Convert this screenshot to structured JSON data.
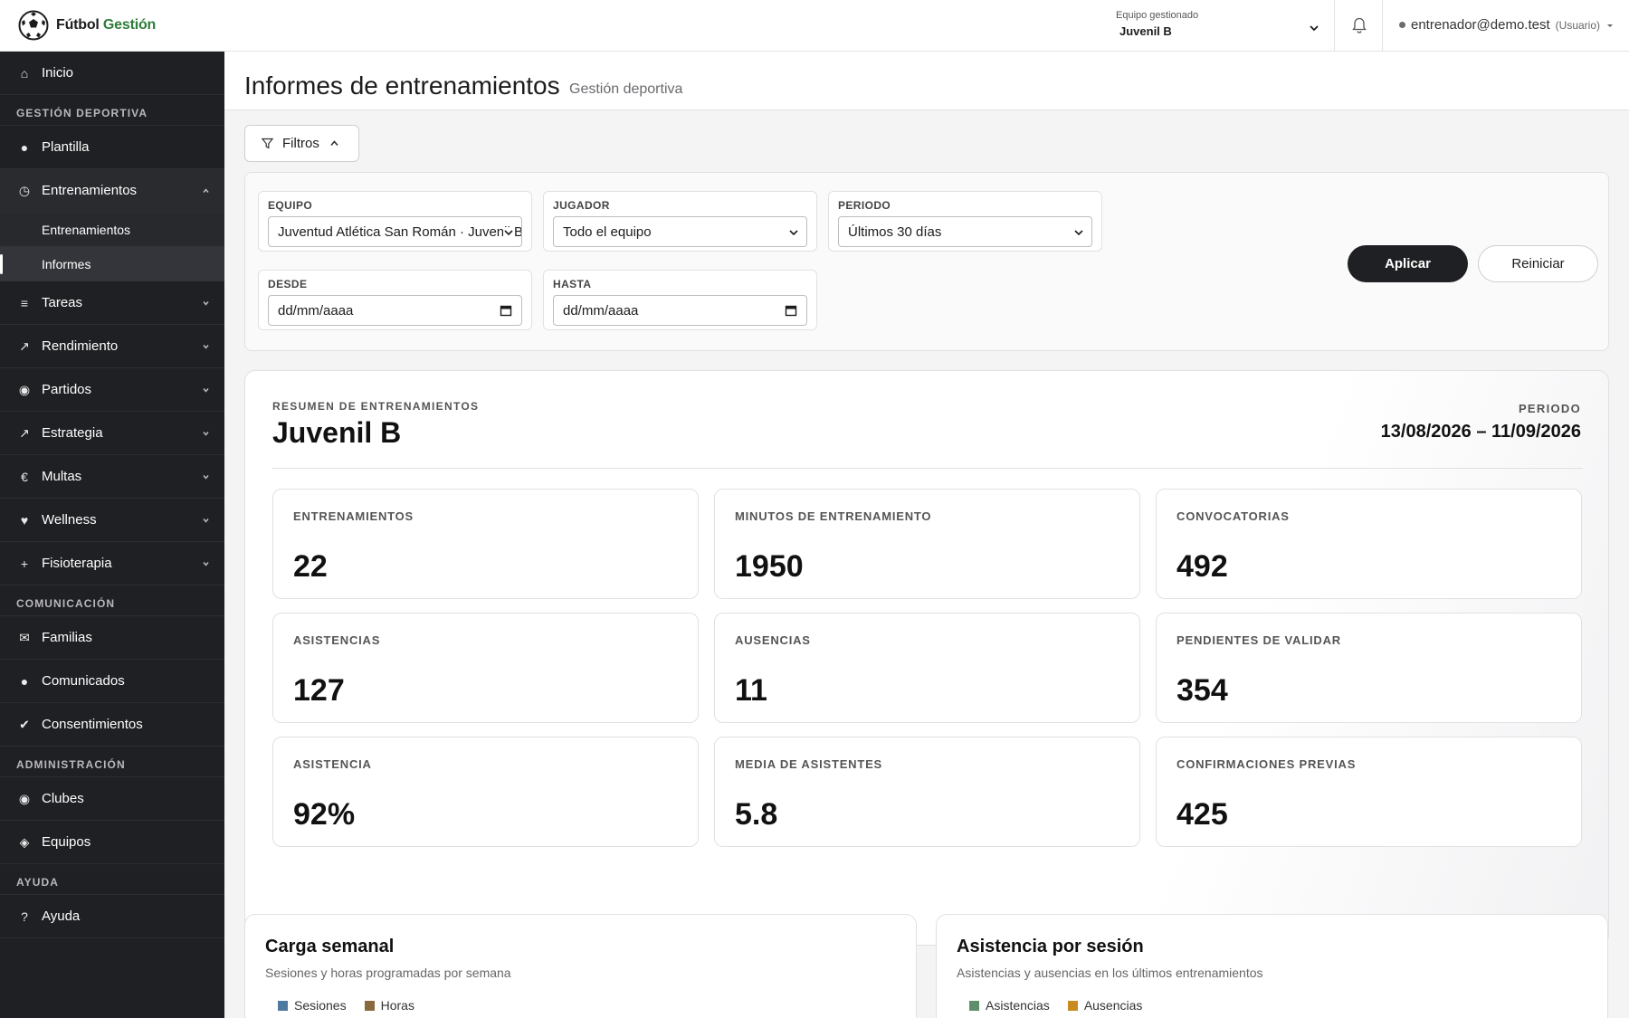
{
  "app": {
    "brand_main": "Fútbol",
    "brand_accent": "Gestión"
  },
  "header": {
    "team_label": "Equipo gestionado",
    "team_value": "Juvenil B",
    "user_email": "entrenador@demo.test",
    "user_role": "(Usuario)"
  },
  "sidebar": {
    "home": "Inicio",
    "sec_deportiva": "GESTIÓN DEPORTIVA",
    "plantilla": "Plantilla",
    "entrenamientos": "Entrenamientos",
    "sub_entrenamientos": "Entrenamientos",
    "sub_informes": "Informes",
    "tareas": "Tareas",
    "rendimiento": "Rendimiento",
    "partidos": "Partidos",
    "estrategia": "Estrategia",
    "multas": "Multas",
    "wellness": "Wellness",
    "fisioterapia": "Fisioterapia",
    "sec_comunicacion": "COMUNICACIÓN",
    "familias": "Familias",
    "comunicados": "Comunicados",
    "consentimientos": "Consentimientos",
    "sec_admin": "ADMINISTRACIÓN",
    "clubes": "Clubes",
    "equipos": "Equipos",
    "sec_ayuda": "AYUDA",
    "ayuda": "Ayuda"
  },
  "page": {
    "title": "Informes de entrenamientos",
    "subtitle": "Gestión deportiva"
  },
  "filters": {
    "toggle_label": "Filtros",
    "equipo_label": "EQUIPO",
    "equipo_value": "Juventud Atlética San Román · Juvenil B",
    "jugador_label": "JUGADOR",
    "jugador_value": "Todo el equipo",
    "periodo_label": "PERIODO",
    "periodo_value": "Últimos 30 días",
    "desde_label": "DESDE",
    "desde_value": "dd/mm/aaaa",
    "hasta_label": "HASTA",
    "hasta_value": "dd/mm/aaaa",
    "apply": "Aplicar",
    "reset": "Reiniciar"
  },
  "summary": {
    "kicker": "RESUMEN DE ENTRENAMIENTOS",
    "team": "Juvenil B",
    "period_label": "PERIODO",
    "period_value": "13/08/2026 – 11/09/2026",
    "stats": [
      {
        "label": "ENTRENAMIENTOS",
        "value": "22"
      },
      {
        "label": "MINUTOS DE ENTRENAMIENTO",
        "value": "1950"
      },
      {
        "label": "CONVOCATORIAS",
        "value": "492"
      },
      {
        "label": "ASISTENCIAS",
        "value": "127"
      },
      {
        "label": "AUSENCIAS",
        "value": "11"
      },
      {
        "label": "PENDIENTES DE VALIDAR",
        "value": "354"
      },
      {
        "label": "ASISTENCIA",
        "value": "92%"
      },
      {
        "label": "MEDIA DE ASISTENTES",
        "value": "5.8"
      },
      {
        "label": "CONFIRMACIONES PREVIAS",
        "value": "425"
      }
    ]
  },
  "cards": {
    "carga": {
      "title": "Carga semanal",
      "subtitle": "Sesiones y horas programadas por semana",
      "legend_1": "Sesiones",
      "color_1": "#4f7aa0",
      "legend_2": "Horas",
      "color_2": "#8a6a3c"
    },
    "asistencia": {
      "title": "Asistencia por sesión",
      "subtitle": "Asistencias y ausencias en los últimos entrenamientos",
      "legend_1": "Asistencias",
      "color_1": "#5f8f6a",
      "legend_2": "Ausencias",
      "color_2": "#c98a1f"
    }
  }
}
